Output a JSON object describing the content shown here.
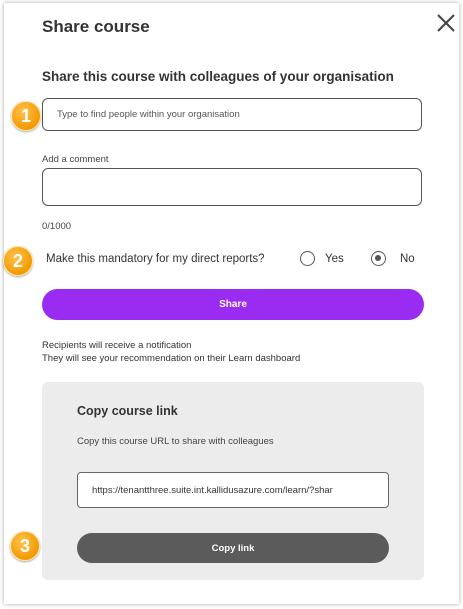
{
  "dialog": {
    "title": "Share course",
    "subtitle": "Share this course with colleagues of your organisation",
    "search": {
      "placeholder": "Type to find people within your organisation",
      "value": ""
    },
    "comment": {
      "label": "Add a comment",
      "value": "",
      "counter": "0/1000"
    },
    "mandatory": {
      "question": "Make this mandatory for my direct reports?",
      "options": [
        "Yes",
        "No"
      ],
      "selected": "No"
    },
    "share_button": "Share",
    "notes": [
      "Recipients will receive a notification",
      "They will see your recommendation on their Learn dashboard"
    ],
    "copy_link": {
      "title": "Copy course link",
      "description": "Copy this course URL to share with colleagues",
      "url": "https://tenantthree.suite.int.kallidusazure.com/learn/?shar",
      "button": "Copy link"
    }
  },
  "markers": [
    "1",
    "2",
    "3"
  ],
  "colors": {
    "primary": "#9a2cf2",
    "secondary_button": "#5b5b5b",
    "marker": "#f39a00",
    "panel": "#ececec"
  },
  "icons": {
    "close": "close-icon"
  }
}
